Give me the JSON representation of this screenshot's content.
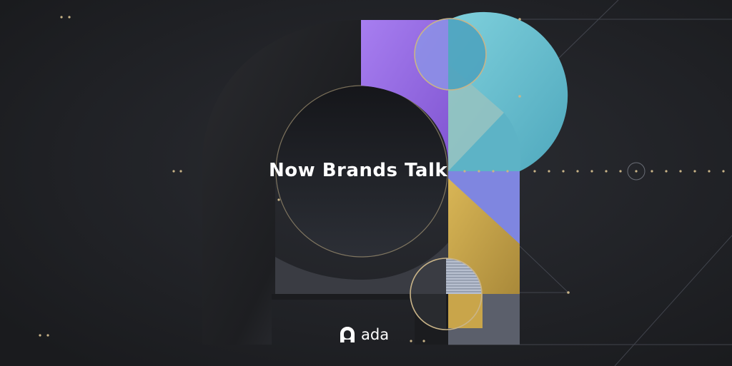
{
  "headline": "Now Brands Talk",
  "brand": {
    "name": "ada",
    "logo_icon": "ada-arch-logo-icon"
  },
  "colors": {
    "background": "#1e1f22",
    "purple": "#9b6ee6",
    "periwinkle": "#7f86e0",
    "teal": "#6bbccb",
    "sage": "#97c2c0",
    "gold": "#c9a54a",
    "slate": "#5b5f6b",
    "ring": "#c9b488"
  }
}
